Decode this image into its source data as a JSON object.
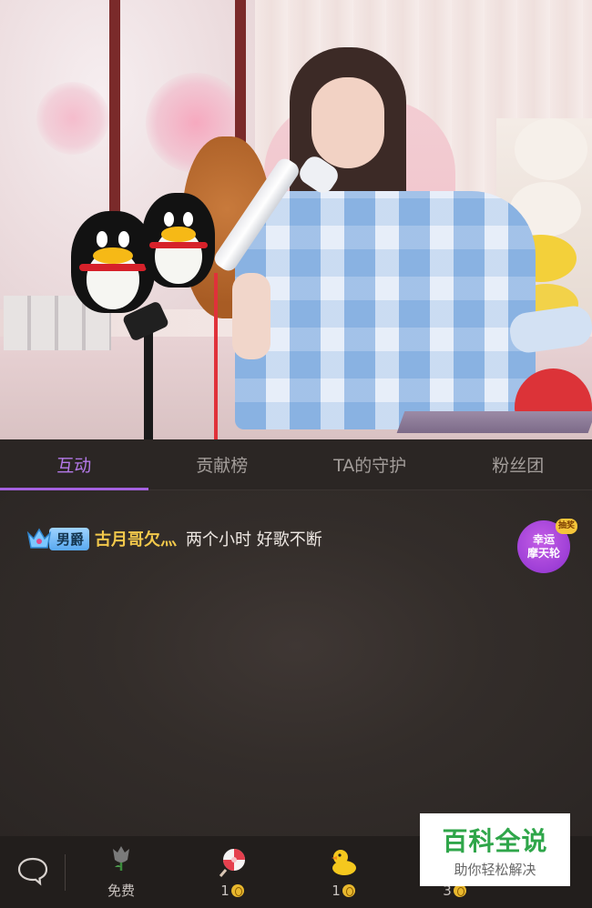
{
  "tabs": [
    {
      "label": "互动",
      "active": true
    },
    {
      "label": "贡献榜",
      "active": false
    },
    {
      "label": "TA的守护",
      "active": false
    },
    {
      "label": "粉丝团",
      "active": false
    }
  ],
  "chat": {
    "messages": [
      {
        "badge": "男爵",
        "user": "古月哥欠灬",
        "text": "两个小时 好歌不断"
      }
    ]
  },
  "lucky_wheel": {
    "line1": "幸运",
    "line2": "摩天轮",
    "tag": "抽奖"
  },
  "toolbar": {
    "gifts": [
      {
        "icon": "rose-icon",
        "price": "免费",
        "coin": false
      },
      {
        "icon": "lollipop-icon",
        "price": "1",
        "coin": true
      },
      {
        "icon": "duck-icon",
        "price": "1",
        "coin": true
      },
      {
        "icon": "gift-icon",
        "price": "3",
        "coin": true
      }
    ]
  },
  "watermark": {
    "title": "百科全说",
    "subtitle": "助你轻松解决"
  },
  "colors": {
    "accent": "#a561e0",
    "username": "#f2c84b",
    "badge": "#59a9f0"
  }
}
